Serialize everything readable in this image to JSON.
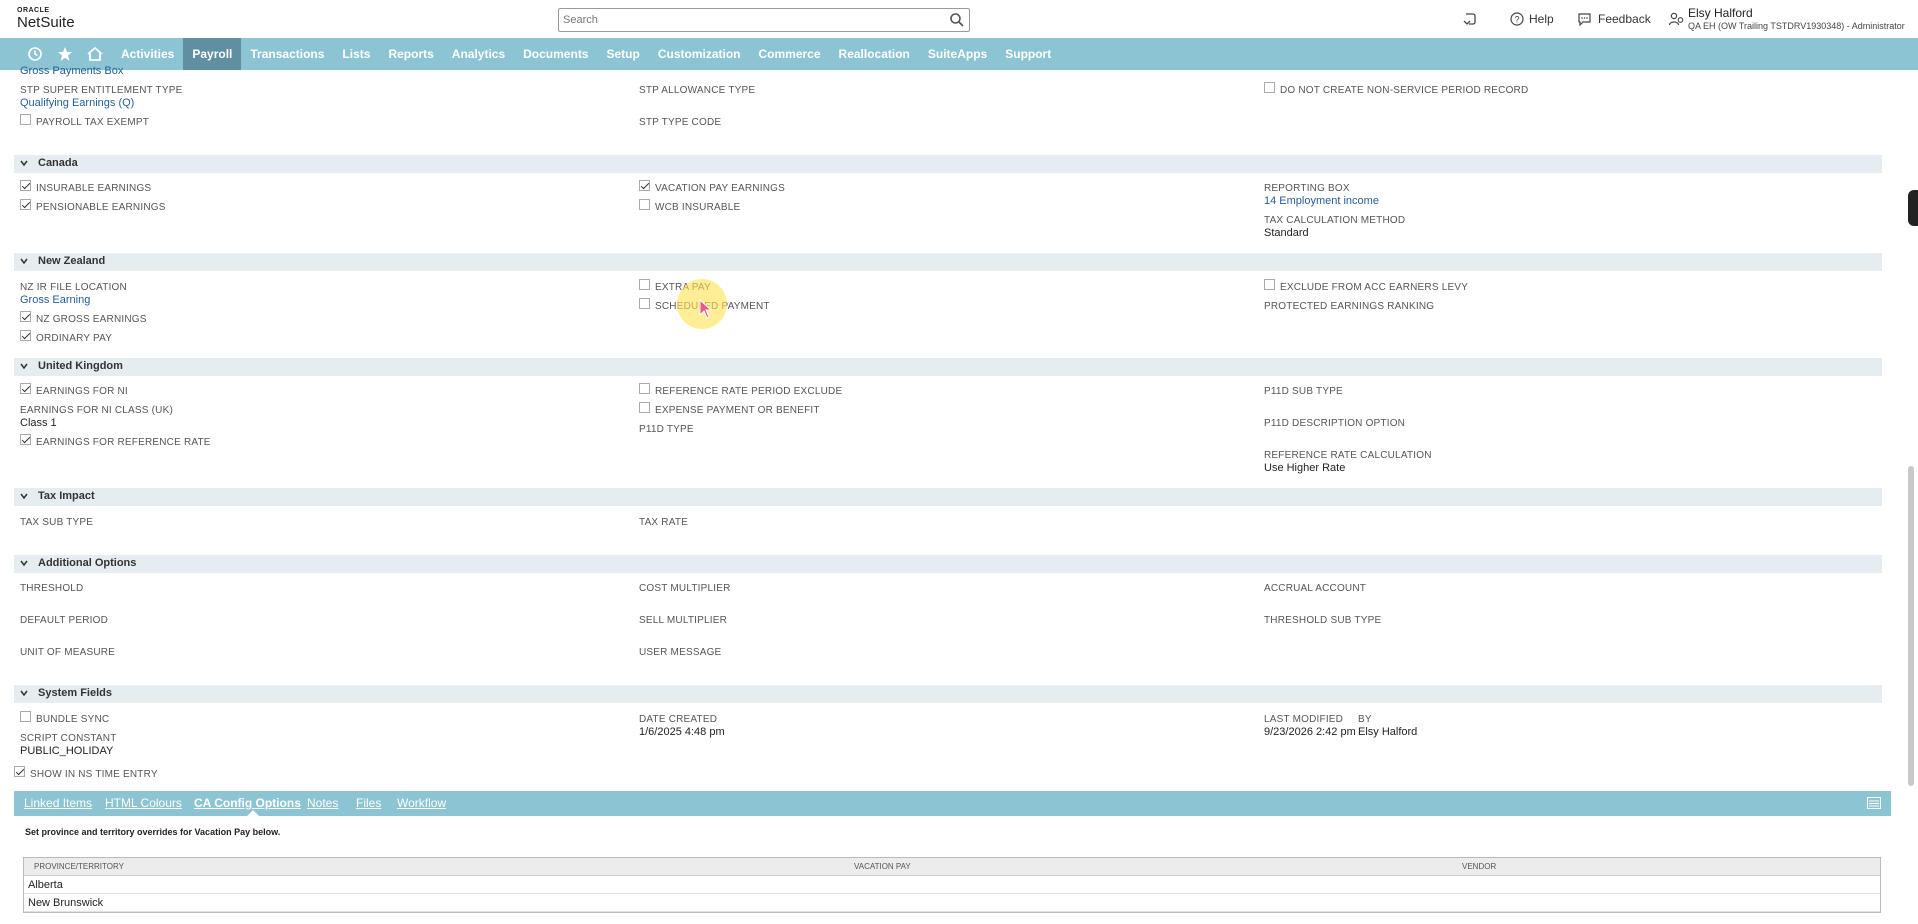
{
  "header": {
    "logo_top": "ORACLE",
    "logo_main": "NetSuite",
    "search_placeholder": "Search",
    "help_label": "Help",
    "feedback_label": "Feedback",
    "user_name": "Elsy Halford",
    "user_role": "QA EH (OW Trailing TSTDRV1930348) - Administrator"
  },
  "nav": {
    "items": [
      "Activities",
      "Payroll",
      "Transactions",
      "Lists",
      "Reports",
      "Analytics",
      "Documents",
      "Setup",
      "Customization",
      "Commerce",
      "Reallocation",
      "SuiteApps",
      "Support"
    ],
    "active": "Payroll"
  },
  "top_fields": {
    "gross_payments_box": "Gross Payments Box",
    "stp_super_label": "STP SUPER ENTITLEMENT TYPE",
    "stp_super_value": "Qualifying Earnings (Q)",
    "payroll_tax_exempt": "PAYROLL TAX EXEMPT",
    "stp_allowance_label": "STP ALLOWANCE TYPE",
    "stp_type_code_label": "STP TYPE CODE",
    "do_not_create": "DO NOT CREATE NON-SERVICE PERIOD RECORD"
  },
  "canada": {
    "title": "Canada",
    "insurable": "INSURABLE EARNINGS",
    "pensionable": "PENSIONABLE EARNINGS",
    "vacation_pay": "VACATION PAY EARNINGS",
    "wcb": "WCB INSURABLE",
    "reporting_box_label": "REPORTING BOX",
    "reporting_box_value": "14 Employment income",
    "tax_calc_label": "TAX CALCULATION METHOD",
    "tax_calc_value": "Standard"
  },
  "nz": {
    "title": "New Zealand",
    "ir_file_label": "NZ IR FILE LOCATION",
    "ir_file_value": "Gross Earning",
    "gross_earnings": "NZ GROSS EARNINGS",
    "ordinary_pay": "ORDINARY PAY",
    "extra_pay": "EXTRA PAY",
    "scheduled_payment": "SCHEDULED PAYMENT",
    "exclude_acc": "EXCLUDE FROM ACC EARNERS LEVY",
    "protected_label": "PROTECTED EARNINGS RANKING"
  },
  "uk": {
    "title": "United Kingdom",
    "earnings_ni": "EARNINGS FOR NI",
    "ni_class_label": "EARNINGS FOR NI CLASS (UK)",
    "ni_class_value": "Class 1",
    "ref_rate": "EARNINGS FOR REFERENCE RATE",
    "ref_rate_period_exclude": "REFERENCE RATE PERIOD EXCLUDE",
    "expense_payment": "EXPENSE PAYMENT OR BENEFIT",
    "p11d_type": "P11D TYPE",
    "p11d_sub_type": "P11D SUB TYPE",
    "p11d_desc": "P11D DESCRIPTION OPTION",
    "ref_rate_calc_label": "REFERENCE RATE CALCULATION",
    "ref_rate_calc_value": "Use Higher Rate"
  },
  "tax_impact": {
    "title": "Tax Impact",
    "tax_sub_type": "TAX SUB TYPE",
    "tax_rate": "TAX RATE"
  },
  "additional": {
    "title": "Additional Options",
    "threshold": "THRESHOLD",
    "default_period": "DEFAULT PERIOD",
    "unit_of_measure": "UNIT OF MEASURE",
    "cost_multiplier": "COST MULTIPLIER",
    "sell_multiplier": "SELL MULTIPLIER",
    "user_message": "USER MESSAGE",
    "accrual_account": "ACCRUAL ACCOUNT",
    "threshold_sub_type": "THRESHOLD SUB TYPE"
  },
  "system": {
    "title": "System Fields",
    "bundle_sync": "BUNDLE SYNC",
    "script_constant_label": "SCRIPT CONSTANT",
    "script_constant_value": "PUBLIC_HOLIDAY",
    "show_in_ns": "SHOW IN NS TIME ENTRY",
    "date_created_label": "DATE CREATED",
    "date_created_value": "1/6/2025 4:48 pm",
    "last_modified_label": "LAST MODIFIED",
    "last_modified_value": "9/23/2026 2:42 pm",
    "by_label": "BY",
    "by_value": "Elsy Halford"
  },
  "subtabs": {
    "items": [
      "Linked Items",
      "HTML Colours",
      "CA Config Options",
      "Notes",
      "Files",
      "Workflow"
    ],
    "active": "CA Config Options",
    "note": "Set province and territory overrides for Vacation Pay below."
  },
  "vacation_table": {
    "headers": [
      "PROVINCE/TERRITORY",
      "VACATION PAY",
      "VENDOR"
    ],
    "rows": [
      "Alberta",
      "New Brunswick"
    ]
  }
}
